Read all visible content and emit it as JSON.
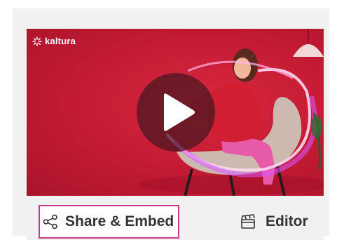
{
  "player": {
    "brand_label": "kaltura",
    "play_icon": "play-icon",
    "brand_color": "#c21a33"
  },
  "actions": {
    "share_embed_label": "Share & Embed",
    "share_icon": "share-icon",
    "editor_label": "Editor",
    "editor_icon": "clapperboard-icon",
    "focus_outline_color": "#c83c8c"
  }
}
